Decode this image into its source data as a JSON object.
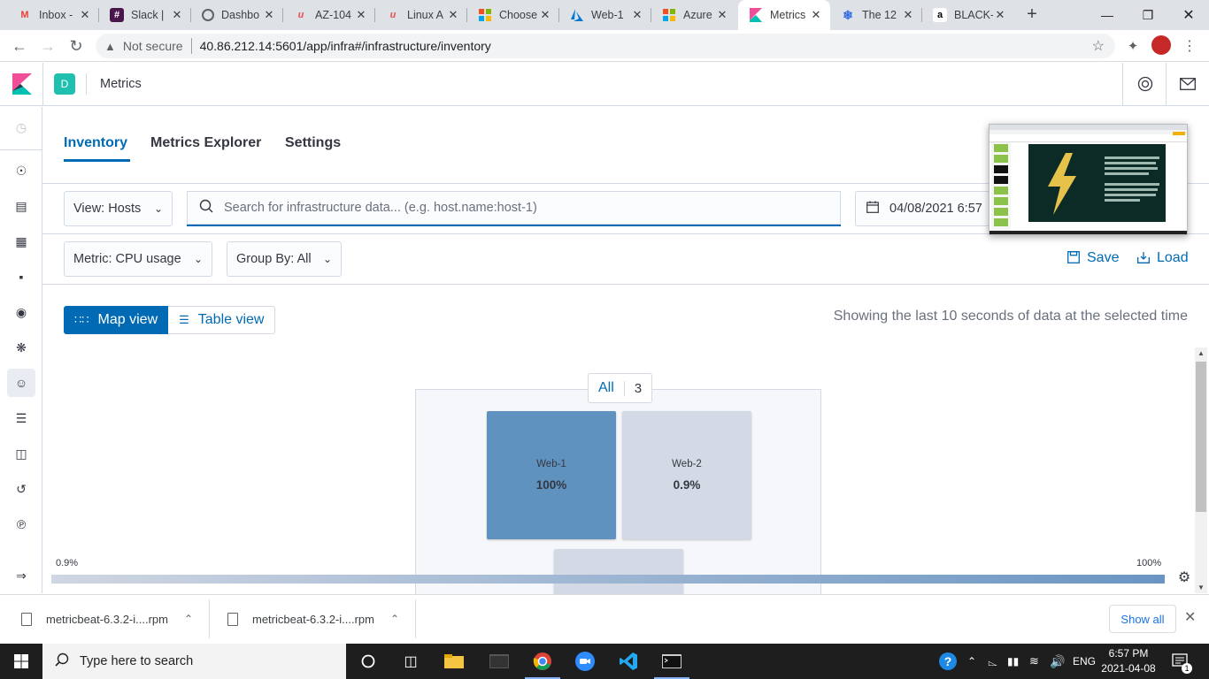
{
  "browser": {
    "tabs": [
      {
        "label": "Inbox -",
        "icon": "gmail-icon"
      },
      {
        "label": "Slack |",
        "icon": "slack-icon"
      },
      {
        "label": "Dashbo",
        "icon": "globe-icon"
      },
      {
        "label": "AZ-104",
        "icon": "udemy-icon"
      },
      {
        "label": "Linux A",
        "icon": "udemy-icon"
      },
      {
        "label": "Choose",
        "icon": "microsoft-icon"
      },
      {
        "label": "Web-1",
        "icon": "azure-icon"
      },
      {
        "label": "Azure -",
        "icon": "microsoft-icon"
      },
      {
        "label": "Metrics",
        "icon": "kibana-icon"
      },
      {
        "label": "The 12",
        "icon": "kubernetes-icon"
      },
      {
        "label": "BLACK-",
        "icon": "amazon-icon"
      }
    ],
    "address": {
      "security": "Not secure",
      "url": "40.86.212.14:5601/app/infra#/infrastructure/inventory"
    }
  },
  "kibana": {
    "space_initial": "D",
    "app_title": "Metrics",
    "tabs": [
      "Inventory",
      "Metrics Explorer",
      "Settings"
    ],
    "view_select": "View: Hosts",
    "search_placeholder": "Search for infrastructure data... (e.g. host.name:host-1)",
    "date": "04/08/2021 6:57",
    "metric_select": "Metric: CPU usage",
    "group_select": "Group By: All",
    "save_label": "Save",
    "load_label": "Load",
    "map_view_label": "Map view",
    "table_view_label": "Table view",
    "showing_text": "Showing the last 10 seconds of data at the selected time",
    "group": {
      "name": "All",
      "count": "3"
    },
    "nodes": [
      {
        "name": "Web-1",
        "value": "100%",
        "color": "#6092c0"
      },
      {
        "name": "Web-2",
        "value": "0.9%",
        "color": "#d3dae6"
      },
      {
        "name": "",
        "value": "",
        "color": "#d3dae6"
      }
    ],
    "legend": {
      "min": "0.9%",
      "max": "100%"
    }
  },
  "downloads": {
    "items": [
      "metricbeat-6.3.2-i....rpm",
      "metricbeat-6.3.2-i....rpm"
    ],
    "show_all": "Show all"
  },
  "taskbar": {
    "search_placeholder": "Type here to search",
    "language": "ENG",
    "time": "6:57 PM",
    "date": "2021-04-08",
    "notification_count": "1"
  }
}
